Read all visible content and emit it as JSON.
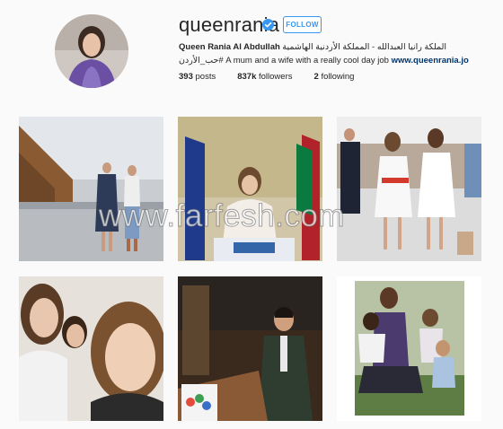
{
  "profile": {
    "username": "queenrania",
    "follow_label": "FOLLOW",
    "full_name": "Queen Rania Al Abdullah",
    "bio_rest": " الملكة رانيا العبدالله - المملكة الأردنية الهاشمية #حب_الأردن A mum and a wife with a really cool day job ",
    "website": "www.queenrania.jo"
  },
  "stats": {
    "posts_count": "393",
    "posts_label": "posts",
    "followers_count": "837k",
    "followers_label": "followers",
    "following_count": "2",
    "following_label": "following"
  },
  "watermark": "www.farfesh.com",
  "colors": {
    "accent": "#3897f0",
    "link": "#003569",
    "background": "#fafafa"
  },
  "icons": {
    "verified": "verified-badge-icon"
  }
}
